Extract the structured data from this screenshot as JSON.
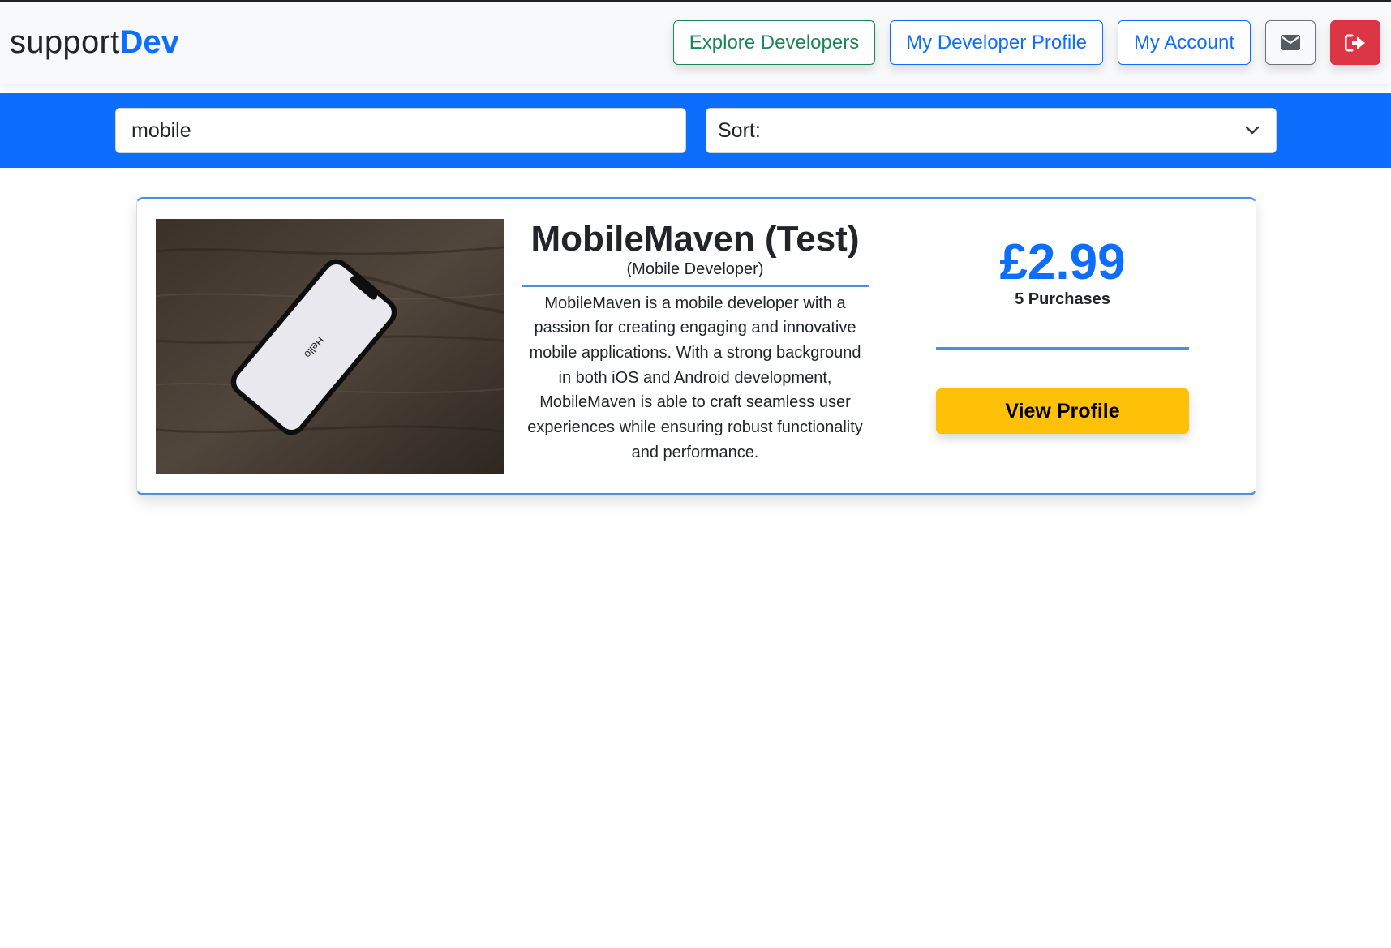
{
  "brand": {
    "part1": "support",
    "part2": "Dev"
  },
  "nav": {
    "explore_label": "Explore Developers",
    "profile_label": "My Developer Profile",
    "account_label": "My Account",
    "mail_icon": "envelope-icon",
    "logout_icon": "sign-out-icon"
  },
  "search": {
    "value": "mobile",
    "sort_label": "Sort:"
  },
  "developer": {
    "name": "MobileMaven (Test)",
    "role": "(Mobile Developer)",
    "description": "MobileMaven is a mobile developer with a passion for creating engaging and innovative mobile applications. With a strong background in both iOS and Android development, MobileMaven is able to craft seamless user experiences while ensuring robust functionality and performance.",
    "image_screen_text": "Hello",
    "price": "£2.99",
    "purchases": "5 Purchases",
    "view_label": "View Profile"
  },
  "colors": {
    "primary": "#0d6efd",
    "success": "#198754",
    "danger": "#dc3545",
    "warning": "#ffc107",
    "accent_line": "#4a90e2"
  }
}
